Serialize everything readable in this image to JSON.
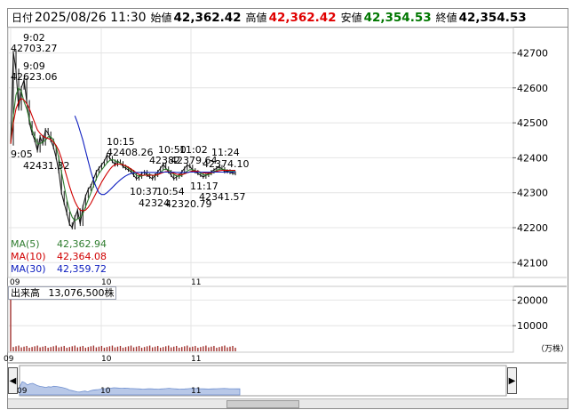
{
  "header": {
    "date_label": "日付",
    "date_value": "2025/08/26 11:30",
    "open_label": "始値",
    "open_value": "42,362.42",
    "high_label": "高値",
    "high_value": "42,362.42",
    "low_label": "安値",
    "low_value": "42,354.53",
    "close_label": "終値",
    "close_value": "42,354.53"
  },
  "colors": {
    "high": "#e00000",
    "low": "#007700",
    "ma5": "#2f7d2f",
    "ma10": "#d00000",
    "ma30": "#1020c0",
    "volume": "#a0302c"
  },
  "moving_averages": [
    {
      "label": "MA(5)",
      "value": "42,362.94",
      "color": "#2f7d2f"
    },
    {
      "label": "MA(10)",
      "value": "42,364.08",
      "color": "#d00000"
    },
    {
      "label": "MA(30)",
      "value": "42,359.72",
      "color": "#1020c0"
    }
  ],
  "volume": {
    "label": "出来高",
    "value": "13,076,500株",
    "unit": "（万株）",
    "y_ticks": [
      "20000",
      "10000"
    ]
  },
  "chart_data": {
    "type": "line",
    "price_axis": {
      "ticks": [
        42100,
        42200,
        42300,
        42400,
        42500,
        42600,
        42700
      ],
      "ylim": [
        42060,
        42770
      ]
    },
    "time_ticks": [
      "09",
      "10",
      "11"
    ],
    "annotations": [
      {
        "time": "9:02",
        "value": "42703.27"
      },
      {
        "time": "9:09",
        "value": "42623.06"
      },
      {
        "time": "9:05",
        "value": "42431.32"
      },
      {
        "time": "10:15",
        "value": "42408.26"
      },
      {
        "time": "10:50",
        "value": "42382"
      },
      {
        "time": "11:02",
        "value": "42379.64"
      },
      {
        "time": "11:24",
        "value": "42374.10"
      },
      {
        "time": "10:37",
        "value": "42324"
      },
      {
        "time": "10:54",
        "value": "42320.79"
      },
      {
        "time": "11:17",
        "value": "42341.57"
      }
    ],
    "price_series": [
      42440,
      42703,
      42650,
      42540,
      42600,
      42623,
      42560,
      42500,
      42470,
      42450,
      42420,
      42460,
      42440,
      42480,
      42470,
      42450,
      42430,
      42400,
      42360,
      42300,
      42270,
      42240,
      42210,
      42200,
      42230,
      42250,
      42210,
      42260,
      42290,
      42310,
      42320,
      42340,
      42360,
      42370,
      42380,
      42390,
      42408,
      42400,
      42390,
      42380,
      42390,
      42385,
      42375,
      42370,
      42365,
      42360,
      42350,
      42340,
      42345,
      42355,
      42360,
      42350,
      42345,
      42340,
      42350,
      42360,
      42370,
      42382,
      42370,
      42360,
      42350,
      42340,
      42345,
      42350,
      42360,
      42370,
      42379,
      42375,
      42365,
      42360,
      42355,
      42350,
      42345,
      42350,
      42355,
      42360,
      42365,
      42370,
      42374,
      42368,
      42360,
      42362,
      42358,
      42356,
      42355
    ],
    "ma_series": [
      {
        "name": "MA(5)",
        "values": [
          42440,
          42520,
          42580,
          42600,
          42590,
          42560,
          42540,
          42510,
          42480,
          42460,
          42440,
          42440,
          42445,
          42450,
          42460,
          42460,
          42450,
          42430,
          42400,
          42360,
          42320,
          42280,
          42250,
          42230,
          42220,
          42225,
          42230,
          42240,
          42260,
          42280,
          42300,
          42320,
          42340,
          42355,
          42365,
          42375,
          42385,
          42392,
          42395,
          42392,
          42388,
          42385,
          42380,
          42375,
          42370,
          42365,
          42358,
          42350,
          42346,
          42348,
          42350,
          42352,
          42352,
          42350,
          42348,
          42352,
          42358,
          42365,
          42368,
          42365,
          42360,
          42352,
          42348,
          42347,
          42350,
          42356,
          42362,
          42366,
          42366,
          42363,
          42360,
          42356,
          42352,
          42350,
          42352,
          42355,
          42360,
          42364,
          42367,
          42368,
          42366,
          42364,
          42362,
          42362,
          42363
        ]
      },
      {
        "name": "MA(10)",
        "values": [
          42440,
          42500,
          42540,
          42560,
          42570,
          42565,
          42555,
          42540,
          42520,
          42500,
          42480,
          42470,
          42462,
          42458,
          42455,
          42452,
          42445,
          42435,
          42420,
          42398,
          42372,
          42345,
          42318,
          42295,
          42275,
          42260,
          42250,
          42248,
          42250,
          42258,
          42270,
          42285,
          42300,
          42315,
          42330,
          42343,
          42355,
          42366,
          42375,
          42380,
          42382,
          42382,
          42380,
          42377,
          42373,
          42368,
          42363,
          42357,
          42352,
          42350,
          42350,
          42350,
          42350,
          42350,
          42350,
          42352,
          42355,
          42358,
          42360,
          42360,
          42358,
          42356,
          42353,
          42352,
          42352,
          42354,
          42357,
          42360,
          42362,
          42362,
          42361,
          42359,
          42357,
          42356,
          42356,
          42357,
          42359,
          42361,
          42363,
          42364,
          42364,
          42364,
          42364,
          42364,
          42364
        ]
      },
      {
        "name": "MA(30)",
        "values": [
          null,
          null,
          null,
          null,
          null,
          null,
          null,
          null,
          null,
          null,
          null,
          null,
          null,
          null,
          null,
          null,
          null,
          null,
          null,
          null,
          null,
          null,
          null,
          null,
          42520,
          42500,
          42475,
          42450,
          42420,
          42390,
          42360,
          42335,
          42315,
          42300,
          42295,
          42295,
          42300,
          42307,
          42315,
          42323,
          42330,
          42337,
          42343,
          42348,
          42352,
          42355,
          42357,
          42358,
          42358,
          42358,
          42358,
          42358,
          42358,
          42358,
          42358,
          42358,
          42358,
          42359,
          42359,
          42359,
          42359,
          42359,
          42358,
          42358,
          42358,
          42358,
          42358,
          42359,
          42359,
          42359,
          42359,
          42359,
          42359,
          42359,
          42359,
          42359,
          42359,
          42359,
          42359,
          42359,
          42359,
          42359,
          42359,
          42359,
          42360
        ]
      }
    ]
  }
}
